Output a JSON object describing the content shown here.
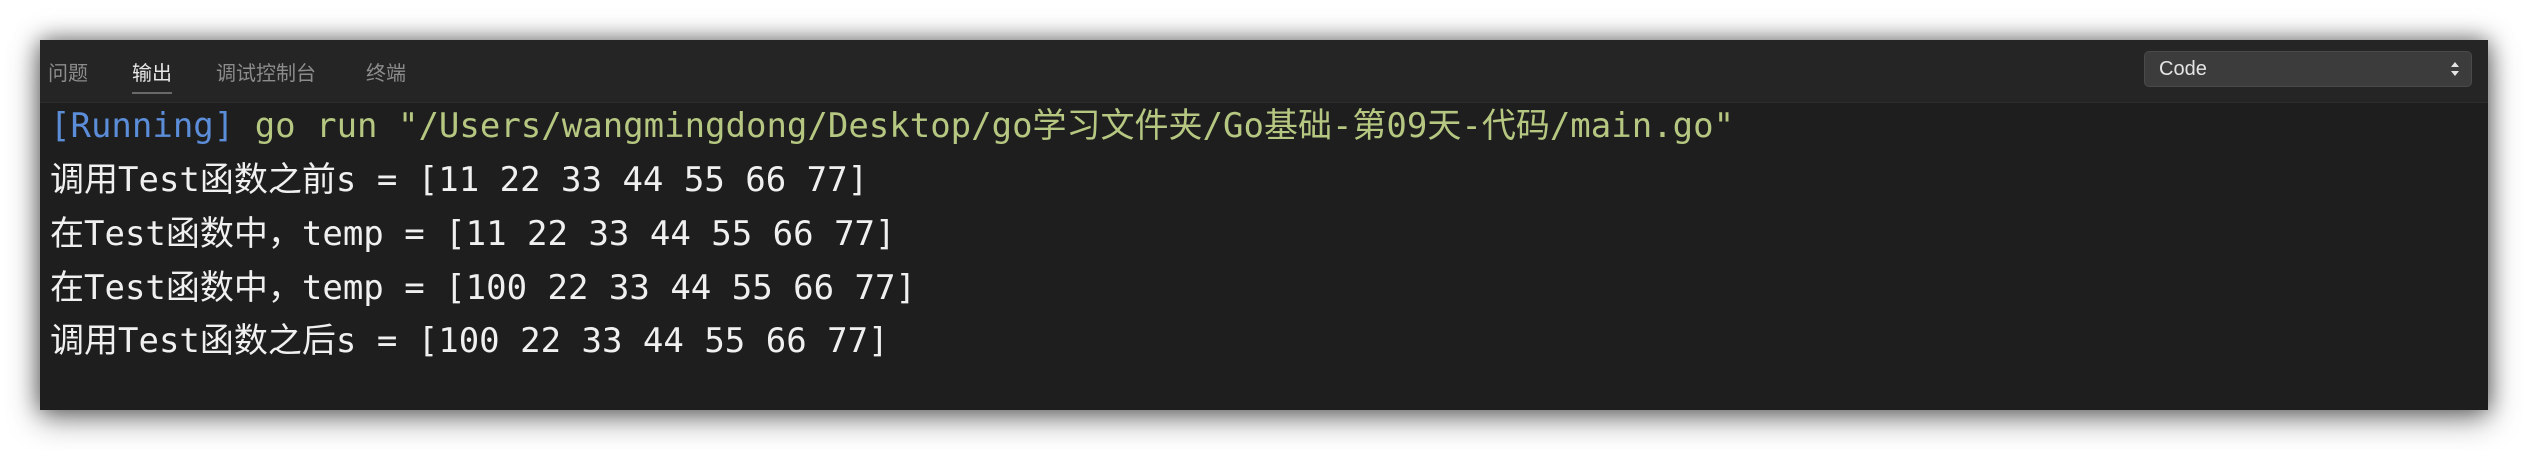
{
  "tabs": [
    {
      "label": "问题"
    },
    {
      "label": "输出"
    },
    {
      "label": "调试控制台"
    },
    {
      "label": "终端"
    }
  ],
  "channel_select": {
    "value": "Code"
  },
  "output": {
    "running_tag": "[Running]",
    "command": " go run \"/Users/wangmingdong/Desktop/go学习文件夹/Go基础-第09天-代码/main.go\"",
    "lines": [
      "调用Test函数之前s = [11 22 33 44 55 66 77]",
      "在Test函数中，temp = [11 22 33 44 55 66 77]",
      "在Test函数中，temp = [100 22 33 44 55 66 77]",
      "调用Test函数之后s = [100 22 33 44 55 66 77]"
    ]
  },
  "colors": {
    "panel_background": "#1e1e1e",
    "header_background": "#252526",
    "running_tag": "#5b8dd9",
    "command_text": "#b5c780",
    "output_text": "#f0f0f0"
  }
}
